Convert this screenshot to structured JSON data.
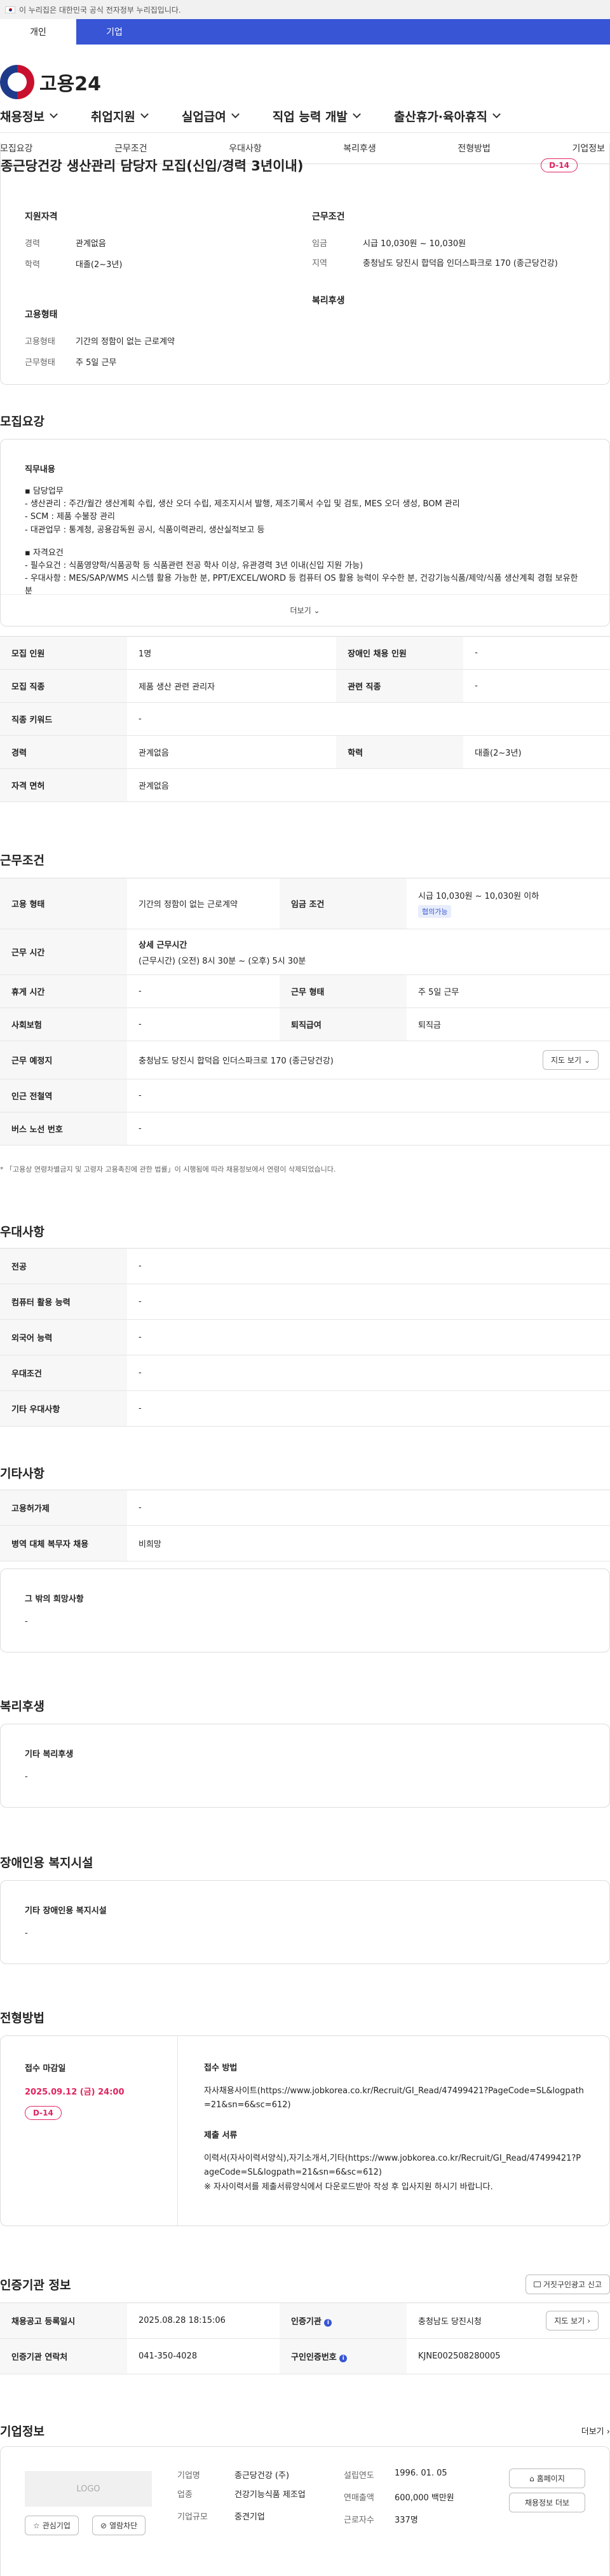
{
  "gov_banner": "이 누리집은 대한민국 공식 전자정부 누리집입니다.",
  "user_tabs": [
    "개인",
    "기업"
  ],
  "logo": "고용24",
  "gnb": [
    "채용정보",
    "취업지원",
    "실업급여",
    "직업 능력 개발",
    "출산휴가·육아휴직"
  ],
  "subnav": [
    "모집요강",
    "근무조건",
    "우대사항",
    "복리후생",
    "전형방법",
    "기업정보"
  ],
  "job": {
    "title": "종근당건강 생산관리 담당자 모집(신입/경력 3년이내)",
    "dday": "D-14",
    "qual_head": "지원자격",
    "qual": [
      [
        "경력",
        "관계없음"
      ],
      [
        "학력",
        "대졸(2~3년)"
      ]
    ],
    "cond_head": "근무조건",
    "cond": [
      [
        "임금",
        "시급 10,030원 ~ 10,030원"
      ],
      [
        "지역",
        "충청남도 당진시 합덕읍 인더스파크로 170 (종근당건강)"
      ]
    ],
    "emp_head": "고용형태",
    "emp": [
      [
        "고용형태",
        "기간의 정함이 없는 근로계약"
      ],
      [
        "근무형태",
        "주 5일 근무"
      ]
    ],
    "welfare_head": "복리후생"
  },
  "recruit": {
    "heading": "모집요강",
    "desc_head": "직무내용",
    "desc": [
      "▪ 담당업무",
      "- 생산관리 : 주간/월간 생산계획 수립, 생산 오더 수립, 제조지시서 발행, 제조기록서 수입 및 검토, MES 오더 생성, BOM 관리",
      "- SCM : 제품 수불장 관리",
      "- 대관업무 : 통계청, 공용감독원 공시, 식품이력관리, 생산실적보고 등",
      "",
      "▪ 자격요건",
      "- 필수요건 : 식품영양학/식품공학 등 식품관련 전공 학사 이상, 유관경력 3년 이내(신입 지원 가능)",
      "- 우대사항 : MES/SAP/WMS 시스템 활용 가능한 분, PPT/EXCEL/WORD 등 컴퓨터 OS 활용 능력이 우수한 분, 건강기능식품/제약/식품 생산계획 경험 보유한 분"
    ],
    "more": "더보기",
    "rows": [
      [
        "모집 인원",
        "1명",
        "장애인 채용 인원",
        "-"
      ],
      [
        "모집 직종",
        "제품 생산 관련 관리자",
        "관련 직종",
        "-"
      ],
      [
        "직종 키워드",
        "-"
      ],
      [
        "경력",
        "관계없음",
        "학력",
        "대졸(2~3년)"
      ],
      [
        "자격 면허",
        "관계없음"
      ]
    ]
  },
  "work": {
    "heading": "근무조건",
    "rows": [
      [
        "고용 형태",
        "기간의 정함이 없는 근로계약",
        "임금 조건",
        "시급 10,030원 ~ 10,030원 이하"
      ],
      [
        "근무 시간",
        "상세 근무시간",
        "(근무시간) (오전) 8시 30분 ~ (오후) 5시 30분"
      ],
      [
        "휴게 시간",
        "-",
        "근무 형태",
        "주 5일 근무"
      ],
      [
        "사회보험",
        "-",
        "퇴직급여",
        "퇴직금"
      ],
      [
        "근무 예정지",
        "충청남도 당진시 합덕읍 인더스파크로 170 (종근당건강)"
      ],
      [
        "인근 전철역",
        "-"
      ],
      [
        "버스 노선 번호",
        "-"
      ]
    ],
    "wage_badge": "협의가능",
    "map_btn": "지도 보기",
    "note": "* 「고용상 연령차별금지 및 고령자 고용촉진에 관한 법률」이 시행됨에 따라 채용정보에서 연령이 삭제되었습니다."
  },
  "pref": {
    "heading": "우대사항",
    "rows": [
      [
        "전공",
        "-"
      ],
      [
        "컴퓨터 활용 능력",
        "-"
      ],
      [
        "외국어 능력",
        "-"
      ],
      [
        "우대조건",
        "-"
      ],
      [
        "기타 우대사항",
        "-"
      ]
    ]
  },
  "etc": {
    "heading": "기타사항",
    "rows": [
      [
        "고용허가제",
        "-"
      ],
      [
        "병역 대체 복무자 채용",
        "비희망"
      ]
    ],
    "other_head": "그 밖의 희망사항",
    "other_val": "-"
  },
  "welfare": {
    "heading": "복리후생",
    "sub": "기타 복리후생",
    "val": "-"
  },
  "disabled": {
    "heading": "장애인용 복지시설",
    "sub": "기타 장애인용 복지시설",
    "val": "-"
  },
  "process": {
    "heading": "전형방법",
    "deadline_head": "접수 마감일",
    "deadline": "2025.09.12 (금) 24:00",
    "dday": "D-14",
    "method_head": "접수 방법",
    "method": "자사채용사이트(https://www.jobkorea.co.kr/Recruit/GI_Read/47499421?PageCode=SL&logpath=21&sn=6&sc=612)",
    "docs_head": "제출 서류",
    "docs": [
      "이력서(자사이력서양식),자기소개서,기타(https://www.jobkorea.co.kr/Recruit/GI_Read/47499421?PageCode=SL&logpath=21&sn=6&sc=612)",
      "※ 자사이력서를 제출서류양식에서 다운로드받아 작성 후 입사지원 하시기 바랍니다."
    ]
  },
  "cert": {
    "heading": "인증기관 정보",
    "report_btn": "거짓구인광고 신고",
    "rows": [
      [
        "채용공고 등록일시",
        "2025.08.28 18:15:06",
        "인증기관",
        "충청남도 당진시청"
      ],
      [
        "인증기관 연락처",
        "041-350-4028",
        "구인인증번호",
        "KJNE002508280005"
      ]
    ],
    "map_btn": "지도 보기"
  },
  "company": {
    "heading": "기업정보",
    "more": "더보기",
    "logo": "LOGO",
    "fav_btn": "관심기업",
    "block_btn": "열람차단",
    "info": [
      [
        "기업명",
        "종근당건강 (주)"
      ],
      [
        "업종",
        "건강기능식품 제조업"
      ],
      [
        "기업규모",
        "중견기업"
      ]
    ],
    "info2": [
      [
        "설립연도",
        "1996. 01. 05"
      ],
      [
        "연매출액",
        "600,000 백만원"
      ],
      [
        "근로자수",
        "337명"
      ]
    ],
    "home_btn": "홈페이지",
    "jobs_btn": "채용정보 더보"
  }
}
